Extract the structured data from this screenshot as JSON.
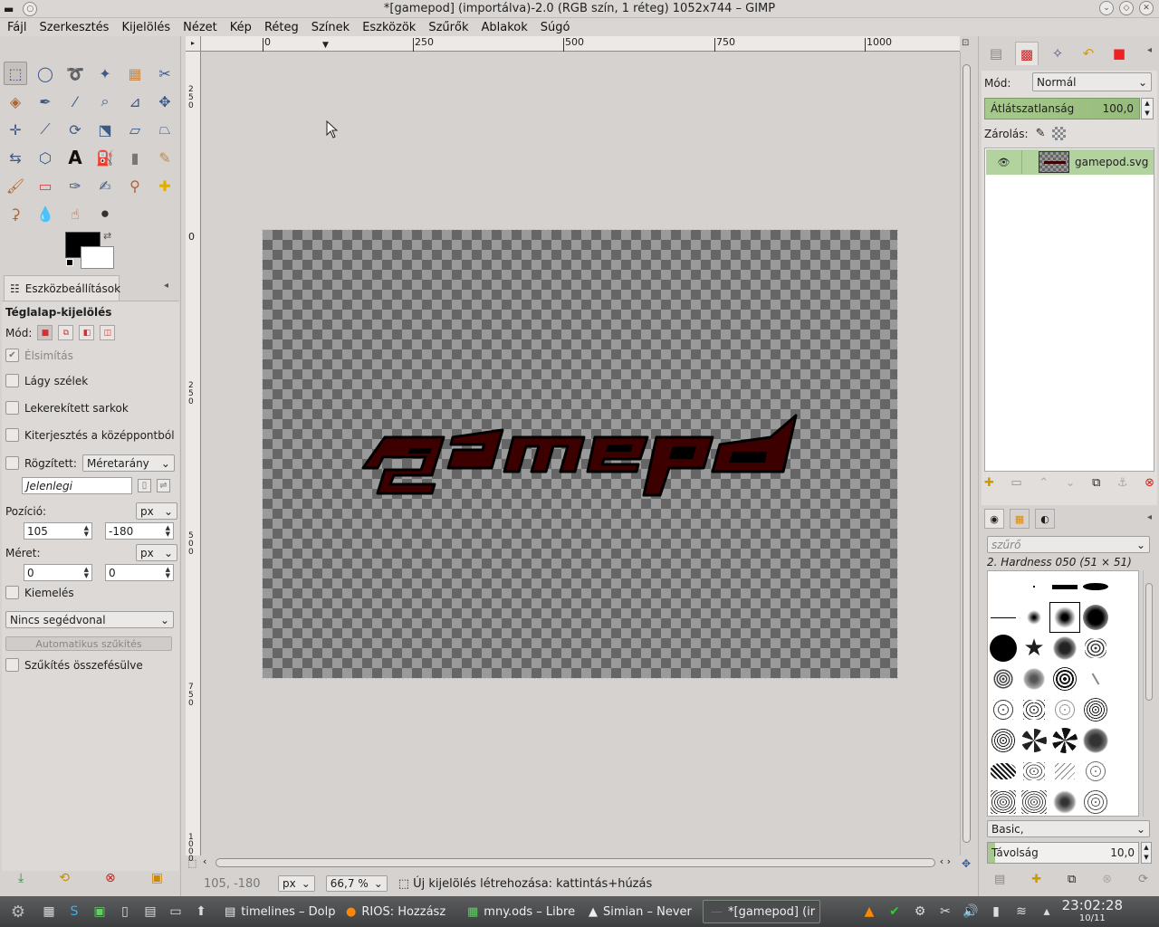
{
  "window": {
    "title": "*[gamepod] (importálva)-2.0 (RGB szín, 1 réteg) 1052x744 – GIMP"
  },
  "menubar": [
    "Fájl",
    "Szerkesztés",
    "Kijelölés",
    "Nézet",
    "Kép",
    "Réteg",
    "Színek",
    "Eszközök",
    "Szűrők",
    "Ablakok",
    "Súgó"
  ],
  "toolbox": {
    "tools": [
      "rect-select",
      "ellipse-select",
      "free-select",
      "fuzzy-select",
      "select-by-color",
      "scissors",
      "foreground-select",
      "paths",
      "color-picker",
      "zoom",
      "measure",
      "move",
      "align",
      "crop",
      "rotate",
      "scale",
      "shear",
      "perspective",
      "flip",
      "cage",
      "text",
      "bucket-fill",
      "blend",
      "pencil",
      "paintbrush",
      "eraser",
      "airbrush",
      "ink",
      "clone",
      "heal",
      "perspective-clone",
      "blur",
      "smudge",
      "dodge-burn"
    ],
    "fg_color": "#000000",
    "bg_color": "#ffffff"
  },
  "tool_options": {
    "tab_label": "Eszközbeállítások",
    "title": "Téglalap-kijelölés",
    "mode_label": "Mód:",
    "antialias": "Élsimítás",
    "feather": "Lágy szélek",
    "rounded": "Lekerekített sarkok",
    "expand_center": "Kiterjesztés a középpontból",
    "fixed_label": "Rögzített:",
    "fixed_value": "Méretarány",
    "current_value": "Jelenlegi",
    "position_label": "Pozíció:",
    "position_unit": "px",
    "pos_x": "105",
    "pos_y": "-180",
    "size_label": "Méret:",
    "size_unit": "px",
    "size_w": "0",
    "size_h": "0",
    "highlight": "Kiemelés",
    "guides": "Nincs segédvonal",
    "auto_shrink": "Automatikus szűkítés",
    "shrink_merged": "Szűkítés összefésülve"
  },
  "rulers": {
    "h_ticks": [
      "0",
      "250",
      "500",
      "750",
      "1000"
    ],
    "v_ticks": [
      "250",
      "0",
      "250",
      "500",
      "750",
      "1000"
    ]
  },
  "statusbar": {
    "coords": "105, -180",
    "unit": "px",
    "zoom": "66,7 %",
    "message": "Új kijelölés létrehozása: kattintás+húzás"
  },
  "layers": {
    "mode_label": "Mód:",
    "mode_value": "Normál",
    "opacity_label": "Átlátszatlanság",
    "opacity_value": "100,0",
    "lock_label": "Zárolás:",
    "layer_name": "gamepod.svg"
  },
  "brushes": {
    "filter_placeholder": "szűrő",
    "selected_name": "2. Hardness 050 (51 × 51)",
    "set": "Basic,",
    "spacing_label": "Távolság",
    "spacing_value": "10,0"
  },
  "taskbar": {
    "tasks": [
      "timelines – Dolp",
      "RIOS: Hozzász",
      "mny.ods – Libre",
      "Simian – Never",
      "*[gamepod] (ir"
    ],
    "time": "23:02:28",
    "date": "10/11"
  }
}
